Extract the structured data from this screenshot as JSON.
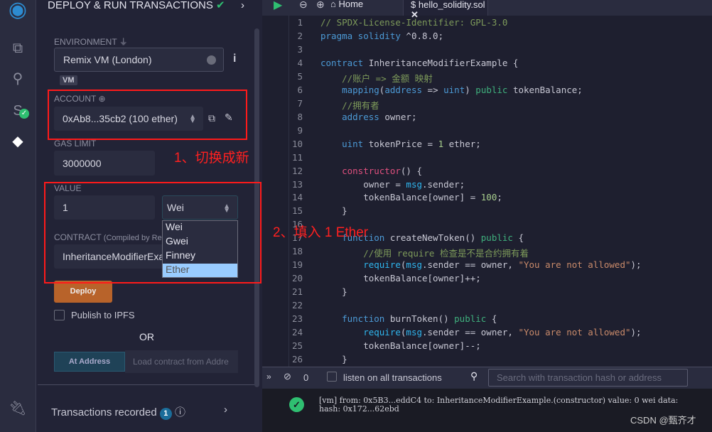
{
  "panel": {
    "title": "DEPLOY & RUN TRANSACTIONS",
    "environment_label": "ENVIRONMENT",
    "environment_value": "Remix VM (London)",
    "vm_badge": "VM",
    "account_label": "ACCOUNT",
    "account_value": "0xAb8...35cb2 (100 ether)",
    "gas_limit_label": "GAS LIMIT",
    "gas_limit_value": "3000000",
    "value_label": "VALUE",
    "value_value": "1",
    "unit_selected": "Wei",
    "unit_options": [
      "Wei",
      "Gwei",
      "Finney",
      "Ether"
    ],
    "unit_highlighted": "Ether",
    "contract_label": "CONTRACT",
    "contract_note": "(Compiled by Re",
    "contract_value": "InheritanceModifierExa",
    "deploy_label": "Deploy",
    "publish_label": "Publish to IPFS",
    "or_label": "OR",
    "at_address_label": "At Address",
    "load_placeholder": "Load contract from Addre",
    "transactions_label": "Transactions recorded",
    "transactions_count": "1"
  },
  "annotations": [
    "1、切换成新",
    "2、填入 1 Ether"
  ],
  "tabs": {
    "home": "Home",
    "file": "hello_solidity.sol"
  },
  "code": [
    [
      [
        "cm",
        "// SPDX-License-Identifier: GPL-3.0"
      ]
    ],
    [
      [
        "kw",
        "pragma solidity"
      ],
      [
        "id",
        " ^0.8.0;"
      ]
    ],
    [],
    [
      [
        "kw",
        "contract"
      ],
      [
        "id",
        " InheritanceModifierExample {"
      ]
    ],
    [
      [
        "cm",
        "    //账户 => 金额 映射"
      ]
    ],
    [
      [
        "kw",
        "    mapping"
      ],
      [
        "id",
        "("
      ],
      [
        "kw",
        "address"
      ],
      [
        "id",
        " => "
      ],
      [
        "kw",
        "uint"
      ],
      [
        "id",
        ") "
      ],
      [
        "pub",
        "public"
      ],
      [
        "id",
        " tokenBalance;"
      ]
    ],
    [
      [
        "cm",
        "    //拥有者"
      ]
    ],
    [
      [
        "kw",
        "    address"
      ],
      [
        "id",
        " owner;"
      ]
    ],
    [],
    [
      [
        "kw",
        "    uint"
      ],
      [
        "id",
        " tokenPrice = "
      ],
      [
        "nm",
        "1"
      ],
      [
        "id",
        " ether;"
      ]
    ],
    [],
    [
      [
        "ct",
        "    constructor"
      ],
      [
        "id",
        "() {"
      ]
    ],
    [
      [
        "id",
        "        owner = "
      ],
      [
        "rq",
        "msg"
      ],
      [
        "id",
        ".sender;"
      ]
    ],
    [
      [
        "id",
        "        tokenBalance[owner] = "
      ],
      [
        "nm",
        "100"
      ],
      [
        "id",
        ";"
      ]
    ],
    [
      [
        "id",
        "    }"
      ]
    ],
    [],
    [
      [
        "kw",
        "    function"
      ],
      [
        "id",
        " createNewToken() "
      ],
      [
        "pub",
        "public"
      ],
      [
        "id",
        " {"
      ]
    ],
    [
      [
        "cm",
        "        //使用 require 检查是不是合约拥有着"
      ]
    ],
    [
      [
        "rq",
        "        require"
      ],
      [
        "id",
        "("
      ],
      [
        "rq",
        "msg"
      ],
      [
        "id",
        ".sender == owner, "
      ],
      [
        "st",
        "\"You are not allowed\""
      ],
      [
        "id",
        ");"
      ]
    ],
    [
      [
        "id",
        "        tokenBalance[owner]++;"
      ]
    ],
    [
      [
        "id",
        "    }"
      ]
    ],
    [],
    [
      [
        "kw",
        "    function"
      ],
      [
        "id",
        " burnToken() "
      ],
      [
        "pub",
        "public"
      ],
      [
        "id",
        " {"
      ]
    ],
    [
      [
        "rq",
        "        require"
      ],
      [
        "id",
        "("
      ],
      [
        "rq",
        "msg"
      ],
      [
        "id",
        ".sender == owner, "
      ],
      [
        "st",
        "\"You are not allowed\""
      ],
      [
        "id",
        ");"
      ]
    ],
    [
      [
        "id",
        "        tokenBalance[owner]--;"
      ]
    ],
    [
      [
        "id",
        "    }"
      ]
    ]
  ],
  "terminal": {
    "count": "0",
    "listen_label": "listen on all transactions",
    "search_placeholder": "Search with transaction hash or address",
    "log_line1": "[vm]  from: 0x5B3...eddC4 to: InheritanceModifierExample.(constructor) value: 0 wei data:",
    "log_line2": "hash: 0x172...62ebd"
  },
  "watermark": "CSDN @甄齐才"
}
